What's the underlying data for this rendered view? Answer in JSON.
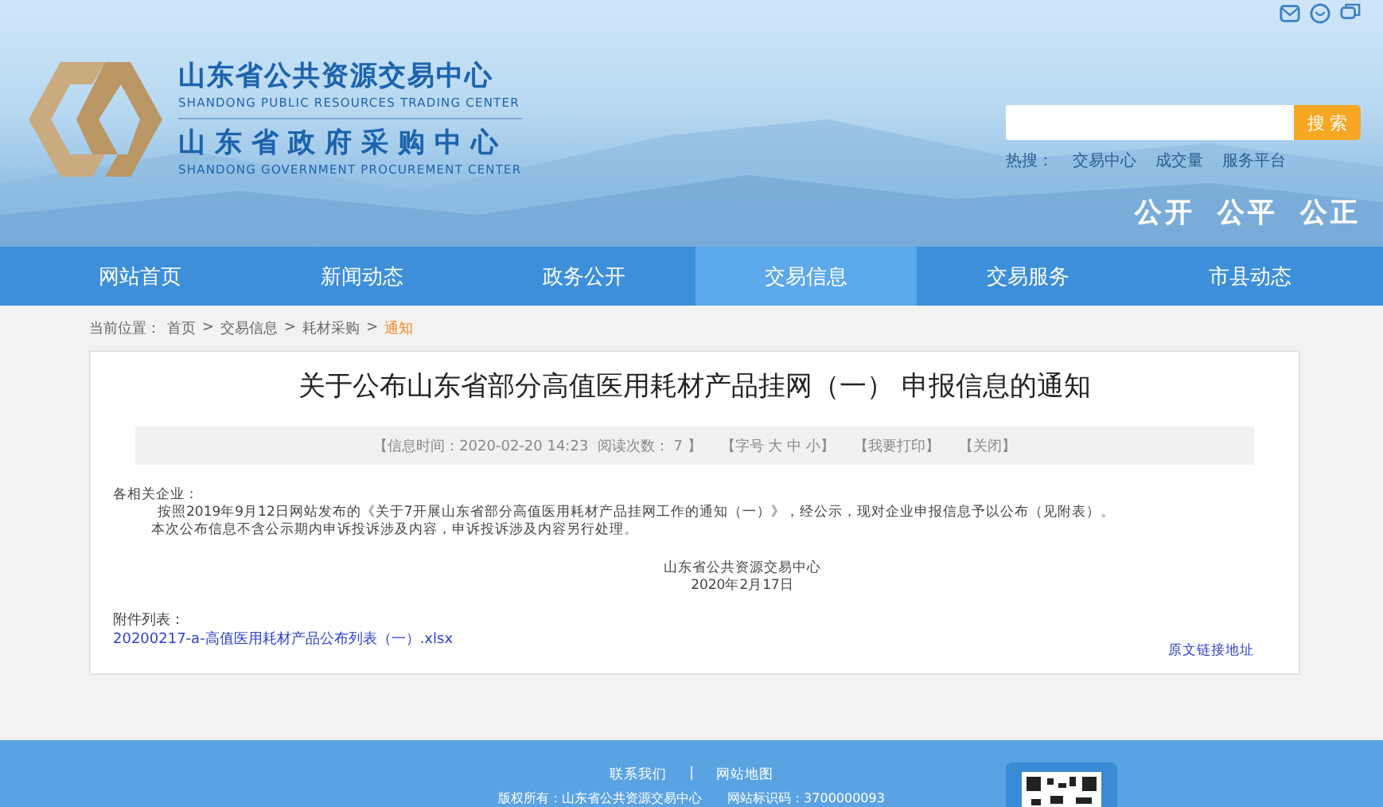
{
  "header": {
    "org_cn": "山东省公共资源交易中心",
    "org_en": "SHANDONG PUBLIC RESOURCES TRADING CENTER",
    "center_cn": "山东省政府采购中心",
    "center_en": "SHANDONG GOVERNMENT PROCUREMENT CENTER",
    "search": {
      "button": "搜 索"
    },
    "hot_label": "热搜：",
    "hot_links": [
      "交易中心",
      "成交量",
      "服务平台"
    ],
    "slogans": [
      "公开",
      "公平",
      "公正"
    ]
  },
  "nav": [
    {
      "label": "网站首页",
      "selected": false
    },
    {
      "label": "新闻动态",
      "selected": false
    },
    {
      "label": "政务公开",
      "selected": false
    },
    {
      "label": "交易信息",
      "selected": true
    },
    {
      "label": "交易服务",
      "selected": false
    },
    {
      "label": "市县动态",
      "selected": false
    }
  ],
  "breadcrumb": {
    "label": "当前位置：",
    "items": [
      {
        "label": "首页",
        "current": false
      },
      {
        "label": "交易信息",
        "current": false
      },
      {
        "label": "耗材采购",
        "current": false
      },
      {
        "label": "通知",
        "current": true
      }
    ],
    "separator": ">"
  },
  "article": {
    "title": "关于公布山东省部分高值医用耗材产品挂网（一） 申报信息的通知",
    "meta": [
      "【信息时间：2020-02-20 14:23  阅读次数： 7 】",
      "【字号 大 中 小】",
      "【我要打印】",
      "【关闭】"
    ],
    "salutation": "各相关企业：",
    "paragraphs": [
      "按照2019年9月12日网站发布的《关于7开展山东省部分高值医用耗材产品挂网工作的通知（一）》，经公示，现对企业申报信息予以公布（见附表）。",
      "本次公布信息不含公示期内申诉投诉涉及内容，申诉投诉涉及内容另行处理。"
    ],
    "signature": [
      "山东省公共资源交易中心",
      "2020年2月17日"
    ],
    "attachments_label": "附件列表：",
    "attachments": [
      "20200217-a-高值医用耗材产品公布列表（一）.xlsx"
    ],
    "source_link": "原文链接地址"
  },
  "footer": {
    "links": [
      "联系我们",
      "网站地图"
    ],
    "separator": "|",
    "info": [
      "版权所有：山东省公共资源交易中心",
      "网站标识码：3700000093"
    ]
  }
}
